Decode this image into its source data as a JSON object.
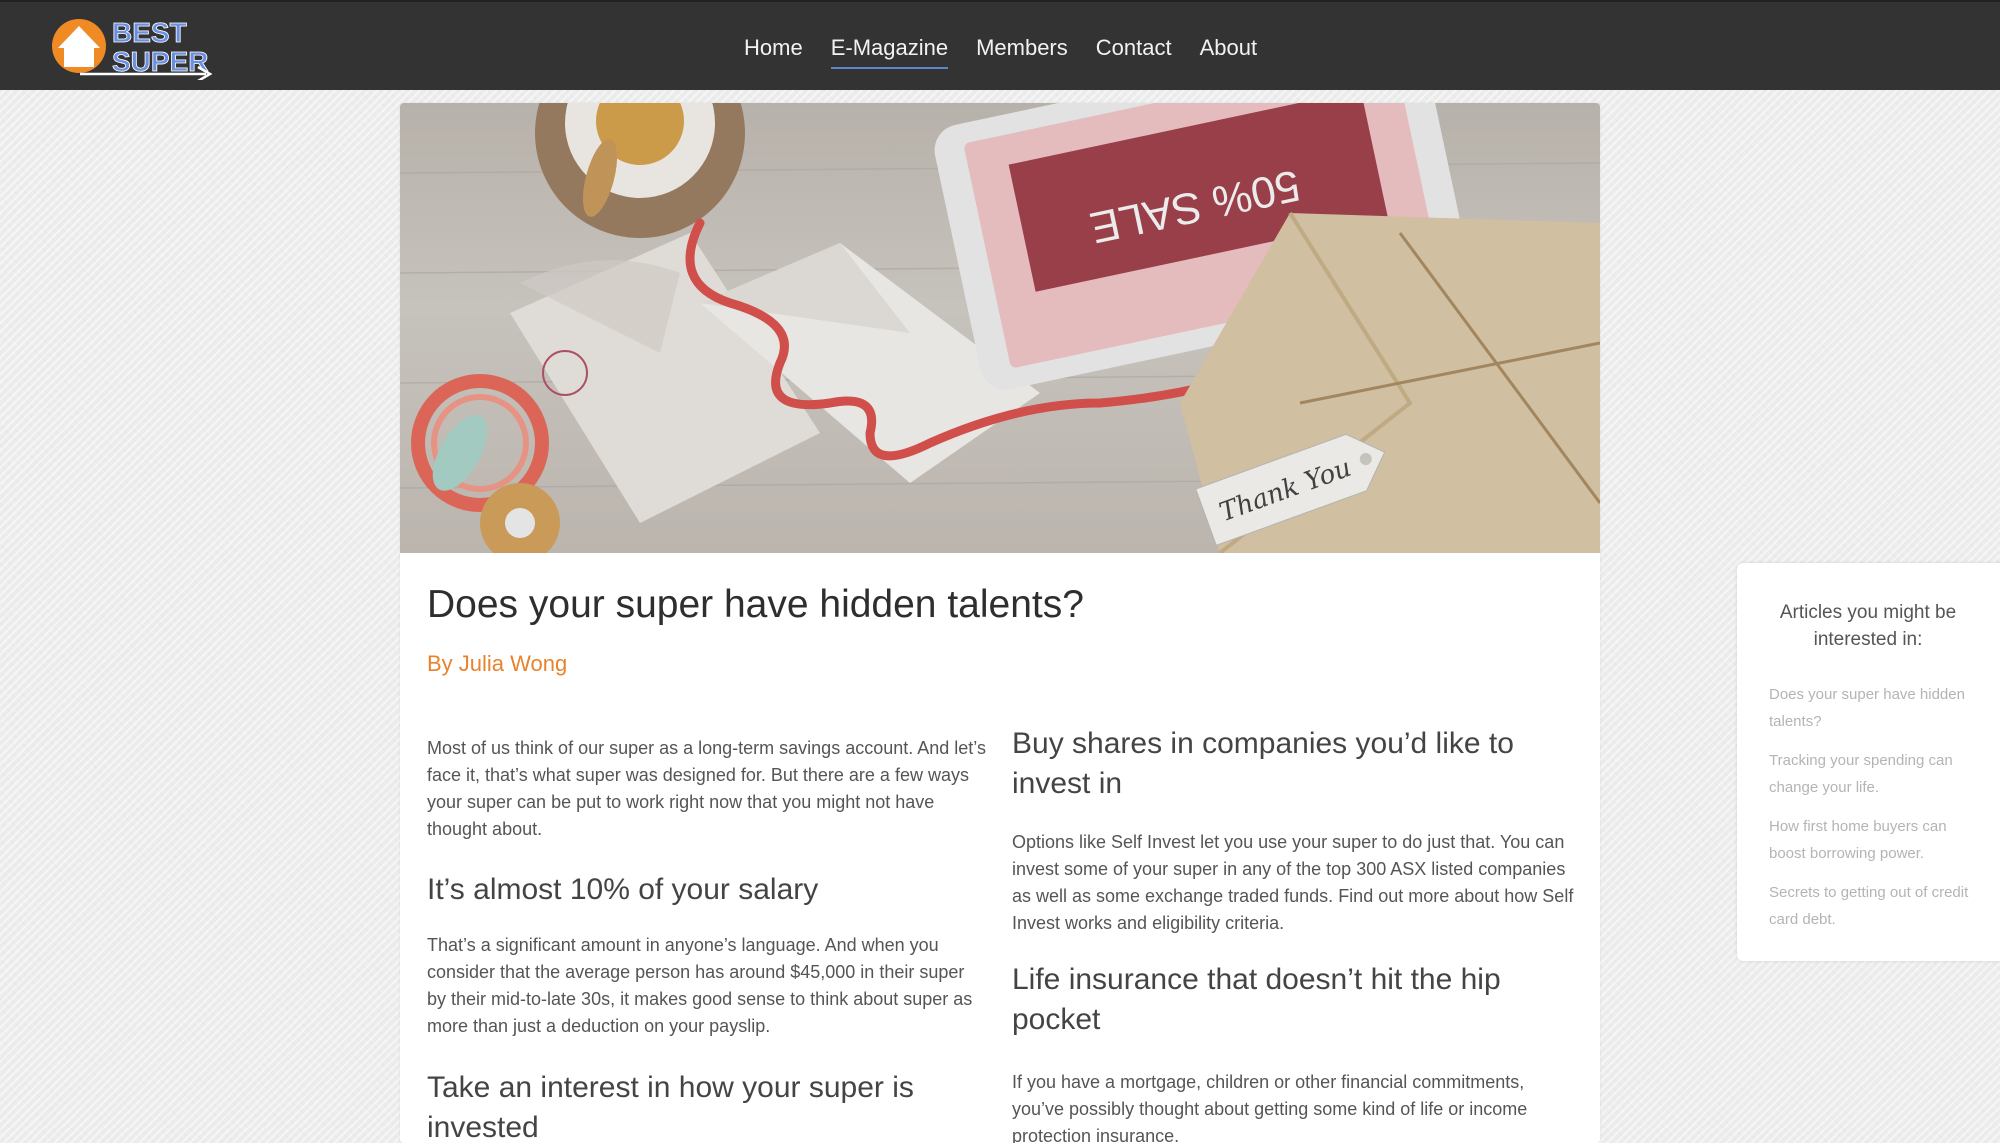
{
  "brand": {
    "logo_line1": "BEST",
    "logo_line2": "SUPER"
  },
  "nav": {
    "items": [
      {
        "label": "Home"
      },
      {
        "label": "E-Magazine",
        "active": true
      },
      {
        "label": "Members"
      },
      {
        "label": "Contact"
      },
      {
        "label": "About"
      }
    ]
  },
  "hero": {
    "screen_text": "50% SALE",
    "tag_text": "Thank You"
  },
  "article": {
    "title": "Does your super have hidden talents?",
    "author": "By Julia Wong",
    "left": {
      "intro": "Most of us think of our super as a long-term savings account. And let’s face it, that’s what super was designed for. But there are a few ways your super can be put to work right now that you might not have thought about.",
      "h1": "It’s almost 10% of your salary",
      "p1": "That’s a significant amount in anyone’s language. And when you consider that the average person has around $45,000 in their super by their mid-to-late 30s, it makes good sense to think about super as more than just a deduction on your payslip.",
      "h2": "Take an interest in how your super is invested"
    },
    "right": {
      "h1": "Buy shares in companies you’d like to invest in",
      "p1": "Options like Self Invest let you use your super to do just that. You can invest some of your super in any of the top 300 ASX listed companies as well as some exchange traded funds. Find out more about how Self Invest works and eligibility criteria.",
      "h2": "Life insurance that doesn’t hit the hip pocket",
      "p2": "If you have a mortgage, children or other financial commitments, you’ve possibly thought about getting some kind of life or income protection insurance."
    }
  },
  "sidebar": {
    "title": "Articles you might be interested in:",
    "links": [
      "Does your super have hidden talents?",
      "Tracking your spending can change your life.",
      "How first home buyers can boost borrowing power.",
      "Secrets to getting out of credit card debt."
    ]
  },
  "colors": {
    "topbar": "#333333",
    "accent_orange": "#e8822c",
    "logo_blue": "#6b8fe0",
    "nav_underline": "#5b86c9"
  }
}
